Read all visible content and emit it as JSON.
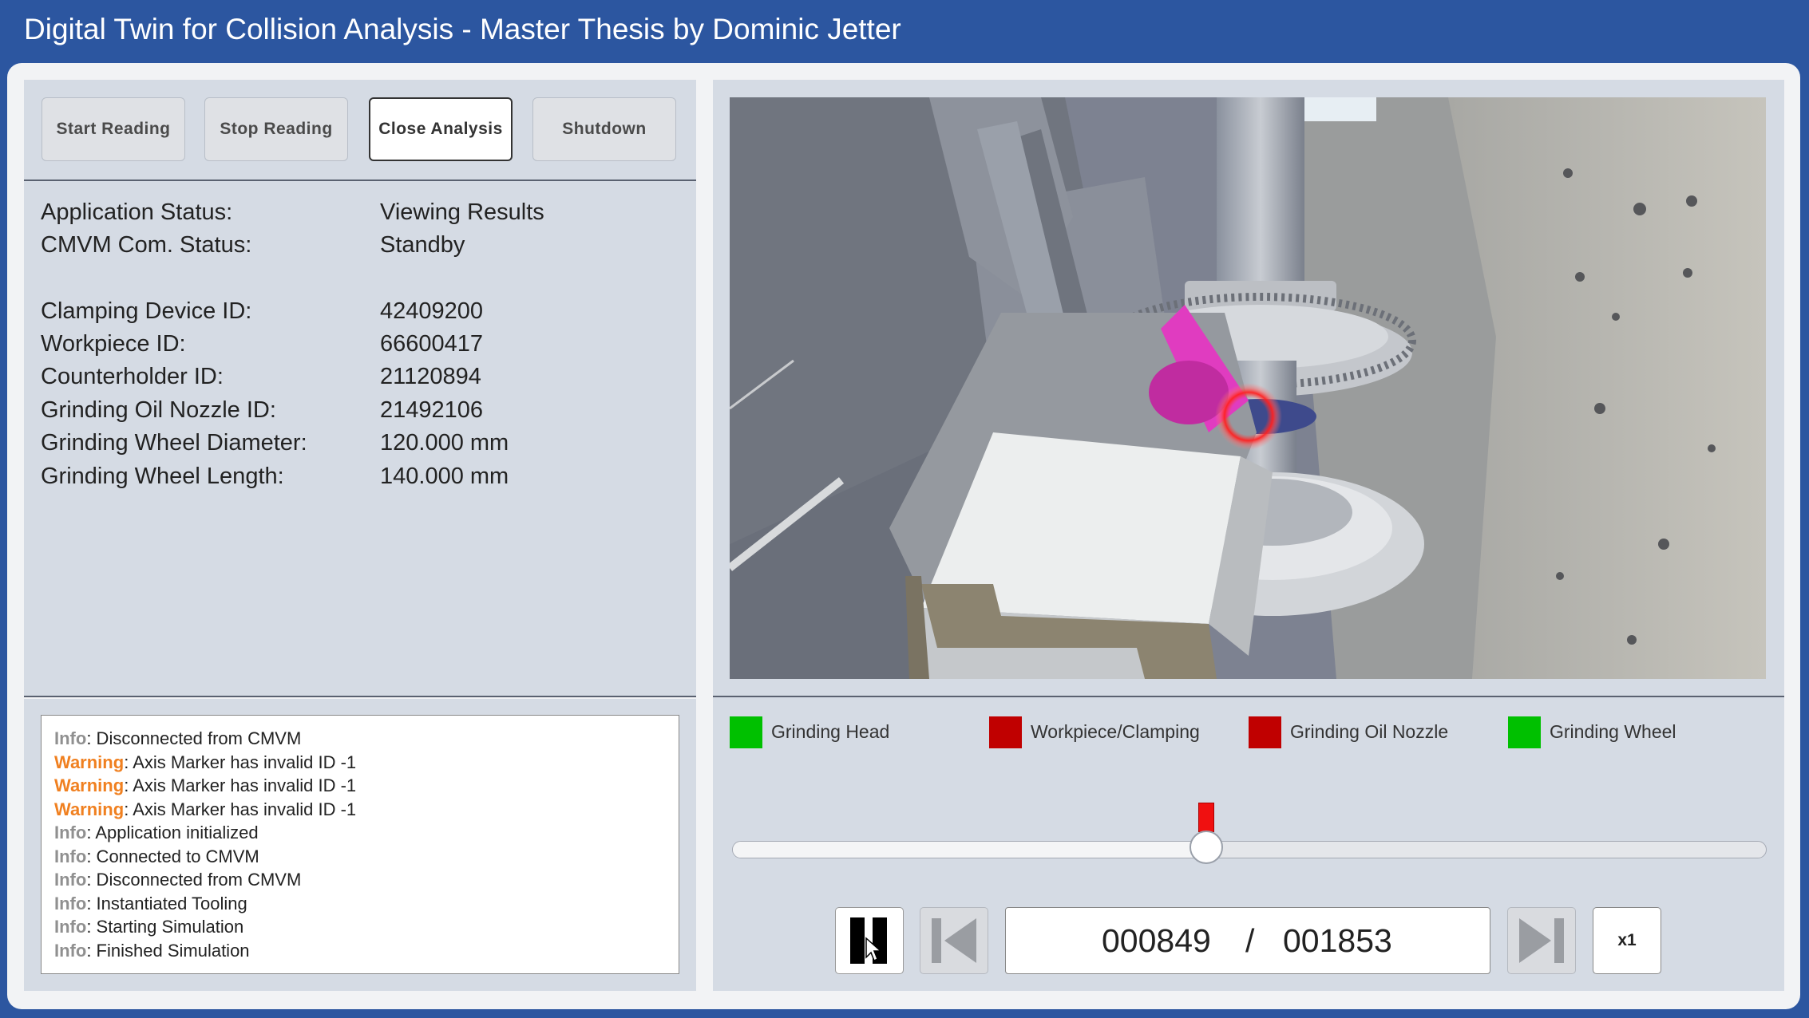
{
  "window": {
    "title": "Digital Twin for Collision Analysis - Master Thesis by Dominic Jetter"
  },
  "toolbar": {
    "start_label": "Start Reading",
    "stop_label": "Stop Reading",
    "close_label": "Close Analysis",
    "shutdown_label": "Shutdown"
  },
  "status": {
    "app_label": "Application Status:",
    "app_value": "Viewing Results",
    "com_label": "CMVM Com. Status:",
    "com_value": "Standby"
  },
  "details": [
    {
      "label": "Clamping Device ID:",
      "value": "42409200"
    },
    {
      "label": "Workpiece ID:",
      "value": "66600417"
    },
    {
      "label": "Counterholder ID:",
      "value": "21120894"
    },
    {
      "label": "Grinding Oil Nozzle ID:",
      "value": "21492106"
    },
    {
      "label": "Grinding Wheel Diameter:",
      "value": "120.000 mm"
    },
    {
      "label": "Grinding Wheel Length:",
      "value": "140.000 mm"
    }
  ],
  "log": [
    {
      "level": "Info",
      "message": ": Disconnected from CMVM"
    },
    {
      "level": "Warning",
      "message": ": Axis Marker has invalid ID -1"
    },
    {
      "level": "Warning",
      "message": ": Axis Marker has invalid ID -1"
    },
    {
      "level": "Warning",
      "message": ": Axis Marker has invalid ID -1"
    },
    {
      "level": "Info",
      "message": ": Application initialized"
    },
    {
      "level": "Info",
      "message": ": Connected to CMVM"
    },
    {
      "level": "Info",
      "message": ": Disconnected from CMVM"
    },
    {
      "level": "Info",
      "message": ": Instantiated Tooling"
    },
    {
      "level": "Info",
      "message": ": Starting Simulation"
    },
    {
      "level": "Info",
      "message": ": Finished Simulation"
    }
  ],
  "legend": [
    {
      "label": "Grinding Head",
      "color": "#00c000"
    },
    {
      "label": "Workpiece/Clamping",
      "color": "#c00000"
    },
    {
      "label": "Grinding Oil Nozzle",
      "color": "#c00000"
    },
    {
      "label": "Grinding Wheel",
      "color": "#00c000"
    }
  ],
  "playback": {
    "current_frame": "000849",
    "separator": "/",
    "total_frames": "001853",
    "speed_label": "x1",
    "progress": 0.458,
    "collision_marker": 0.458
  },
  "colors": {
    "accent": "#2c56a0",
    "collision": "#f01010",
    "warning": "#f08020"
  }
}
